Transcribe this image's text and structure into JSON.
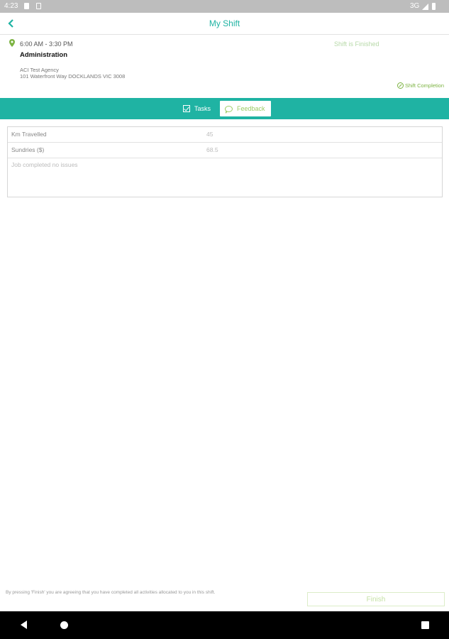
{
  "status_bar": {
    "time": "4:23",
    "network": "3G"
  },
  "header": {
    "title": "My Shift",
    "back_icon": "chevron-left-icon"
  },
  "shift": {
    "time": "6:00 AM - 3:30 PM",
    "status": "Shift is Finished",
    "role": "Administration",
    "agency": "ACI Test Agency",
    "address": "101 Waterfront Way DOCKLANDS VIC 3008",
    "completion_link": "Shift Completion"
  },
  "tabs": [
    {
      "label": "Tasks",
      "icon": "checkbox-icon",
      "active": false
    },
    {
      "label": "Feedback",
      "icon": "speech-bubble-icon",
      "active": true
    }
  ],
  "form": {
    "km_label": "Km Travelled",
    "km_value": "45",
    "sundries_label": "Sundries ($)",
    "sundries_value": "68.5",
    "comments_value": "Job completed no issues"
  },
  "footer": {
    "disclaimer": "By pressing 'Finish' you are agreeing that you have completed all activities allocated to you in this shift.",
    "finish_label": "Finish"
  },
  "colors": {
    "accent": "#1fb3a3",
    "green": "#9ccc65",
    "status_bar": "#bdbdbd"
  }
}
